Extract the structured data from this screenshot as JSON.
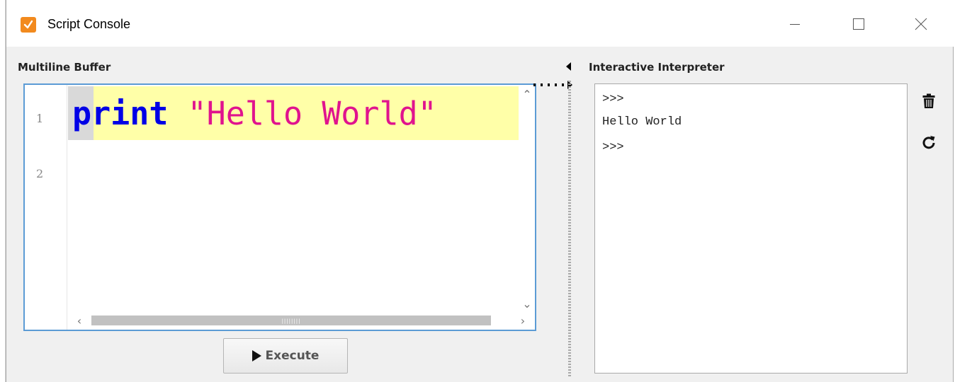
{
  "window": {
    "title": "Script Console",
    "accent_color": "#f28a1e",
    "icon": "script-console-app-icon"
  },
  "buffer": {
    "label": "Multiline Buffer",
    "line_numbers": [
      "1",
      "2"
    ],
    "code_keyword": "print",
    "code_string": "\"Hello World\"",
    "keyword_color": "#0000e6",
    "string_color": "#e0138e",
    "current_line_highlight": "#ffffa8"
  },
  "execute": {
    "label": "Execute",
    "icon": "play-icon"
  },
  "interpreter": {
    "label": "Interactive Interpreter",
    "lines": [
      ">>>",
      "Hello World",
      ">>>"
    ],
    "clear_icon": "trash-icon",
    "reset_icon": "refresh-icon"
  }
}
